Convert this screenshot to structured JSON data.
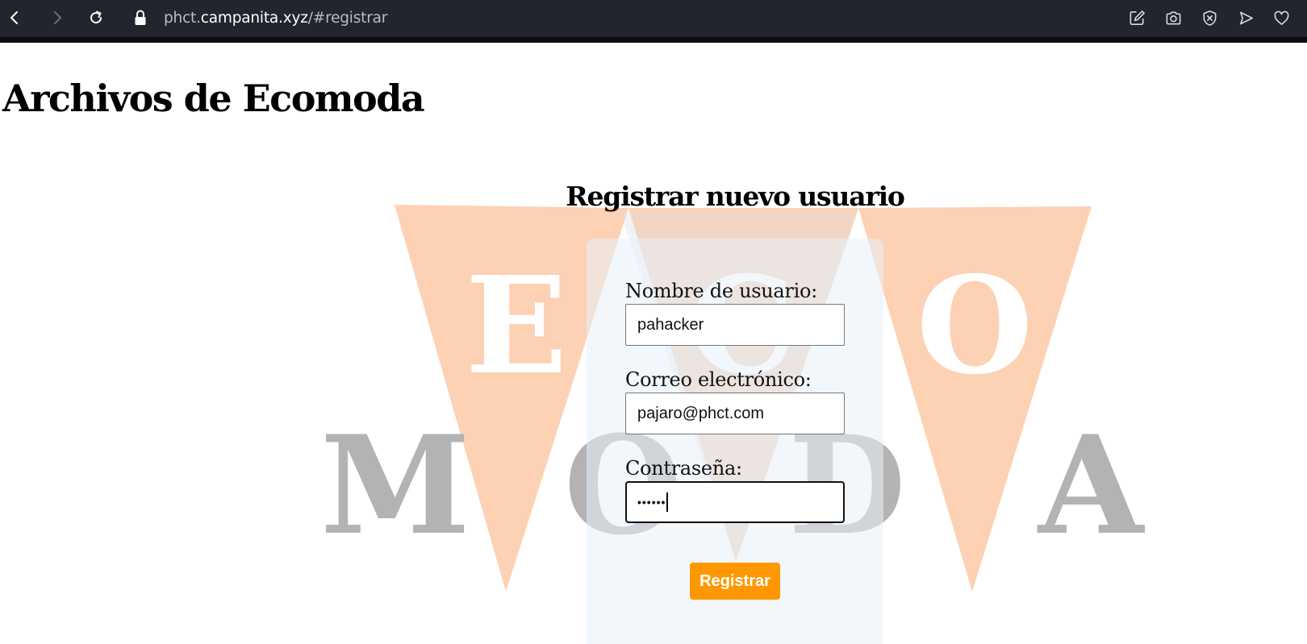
{
  "browser": {
    "url_prefix": "phct.",
    "url_host": "campanita.xyz",
    "url_suffix": "/#registrar",
    "nav_icons": [
      "back-icon",
      "forward-icon",
      "reload-icon"
    ],
    "toolbar_icons": [
      "edit-icon",
      "camera-icon",
      "shield-icon",
      "send-icon",
      "heart-icon"
    ]
  },
  "page": {
    "site_title": "Archivos de Ecomoda"
  },
  "background_logo": {
    "top_letters": [
      "E",
      "C",
      "O"
    ],
    "bottom_letters": [
      "M",
      "O",
      "D",
      "A"
    ],
    "colors": {
      "triangle": "#fdd1b3",
      "top_letters": "#ffffff",
      "bottom_letters": "#b3b3b3"
    }
  },
  "form": {
    "title": "Registrar nuevo usuario",
    "username_label": "Nombre de usuario:",
    "username_value": "pahacker",
    "email_label": "Correo electrónico:",
    "email_value": "pajaro@phct.com",
    "password_label": "Contraseña:",
    "password_mask": "••••••",
    "submit_label": "Registrar"
  },
  "colors": {
    "accent": "#ff9800",
    "chrome_bg": "#22252d",
    "card_bg": "#eef5fc"
  }
}
